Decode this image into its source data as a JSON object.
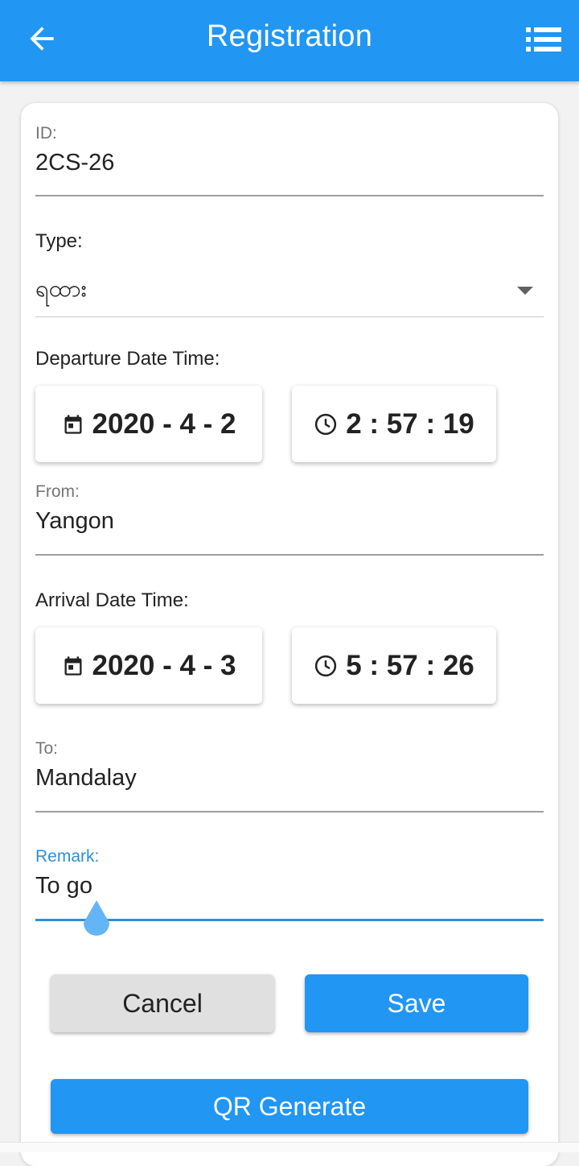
{
  "appbar": {
    "title": "Registration",
    "back_icon": "arrow-back-icon",
    "menu_icon": "list-icon",
    "color": "#2196f3"
  },
  "form": {
    "id": {
      "label": "ID:",
      "value": "2CS-26"
    },
    "type": {
      "label": "Type:",
      "value": "ရထား"
    },
    "departure": {
      "label": "Departure Date Time:",
      "date": "2020 - 4 - 2",
      "time": "2 : 57 : 19"
    },
    "from": {
      "label": "From:",
      "value": "Yangon"
    },
    "arrival": {
      "label": "Arrival Date Time:",
      "date": "2020 - 4 - 3",
      "time": "5 : 57 : 26"
    },
    "to": {
      "label": "To:",
      "value": "Mandalay"
    },
    "remark": {
      "label": "Remark:",
      "value": "To go"
    }
  },
  "buttons": {
    "cancel": "Cancel",
    "save": "Save",
    "qr": "QR Generate"
  },
  "colors": {
    "accent": "#2196f3",
    "focus": "#2f8fd8"
  }
}
